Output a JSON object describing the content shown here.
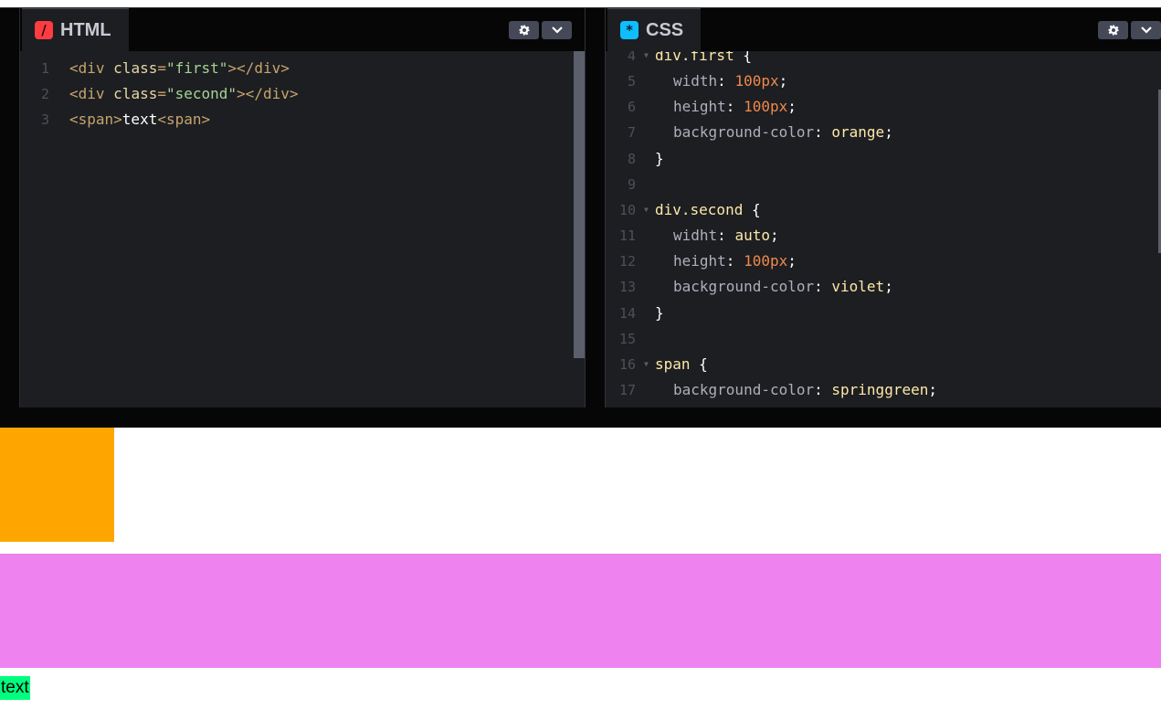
{
  "html_panel": {
    "tab_label": "HTML",
    "tab_icon": "html-slash-icon",
    "lines": [
      {
        "num": "1",
        "tokens": [
          [
            "t-tag",
            "<div "
          ],
          [
            "t-attr",
            "class"
          ],
          [
            "t-tag",
            "="
          ],
          [
            "t-str",
            "\"first\""
          ],
          [
            "t-tag",
            "></div>"
          ]
        ]
      },
      {
        "num": "2",
        "tokens": [
          [
            "t-tag",
            "<div "
          ],
          [
            "t-attr",
            "class"
          ],
          [
            "t-tag",
            "="
          ],
          [
            "t-str",
            "\"second\""
          ],
          [
            "t-tag",
            "></div>"
          ]
        ]
      },
      {
        "num": "3",
        "tokens": [
          [
            "t-tag",
            "<span>"
          ],
          [
            "t-text",
            "text"
          ],
          [
            "t-tag",
            "<span>"
          ]
        ]
      }
    ]
  },
  "css_panel": {
    "tab_label": "CSS",
    "tab_icon": "css-asterisk-icon",
    "lines": [
      {
        "num": "4",
        "fold": true,
        "indent": 0,
        "tokens": [
          [
            "t-sel",
            "div.first "
          ],
          [
            "t-pun",
            "{"
          ]
        ]
      },
      {
        "num": "5",
        "indent": 1,
        "tokens": [
          [
            "t-prop",
            "width"
          ],
          [
            "t-pun",
            ": "
          ],
          [
            "t-num",
            "100px"
          ],
          [
            "t-pun",
            ";"
          ]
        ]
      },
      {
        "num": "6",
        "indent": 1,
        "tokens": [
          [
            "t-prop",
            "height"
          ],
          [
            "t-pun",
            ": "
          ],
          [
            "t-num",
            "100px"
          ],
          [
            "t-pun",
            ";"
          ]
        ]
      },
      {
        "num": "7",
        "indent": 1,
        "tokens": [
          [
            "t-prop",
            "background-color"
          ],
          [
            "t-pun",
            ": "
          ],
          [
            "t-val",
            "orange"
          ],
          [
            "t-pun",
            ";"
          ]
        ]
      },
      {
        "num": "8",
        "indent": 0,
        "tokens": [
          [
            "t-pun",
            "}"
          ]
        ]
      },
      {
        "num": "9",
        "indent": 0,
        "tokens": []
      },
      {
        "num": "10",
        "fold": true,
        "indent": 0,
        "tokens": [
          [
            "t-sel",
            "div.second "
          ],
          [
            "t-pun",
            "{"
          ]
        ]
      },
      {
        "num": "11",
        "indent": 1,
        "tokens": [
          [
            "t-prop",
            "widht"
          ],
          [
            "t-pun",
            ": "
          ],
          [
            "t-val",
            "auto"
          ],
          [
            "t-pun",
            ";"
          ]
        ]
      },
      {
        "num": "12",
        "indent": 1,
        "tokens": [
          [
            "t-prop",
            "height"
          ],
          [
            "t-pun",
            ": "
          ],
          [
            "t-num",
            "100px"
          ],
          [
            "t-pun",
            ";"
          ]
        ]
      },
      {
        "num": "13",
        "indent": 1,
        "tokens": [
          [
            "t-prop",
            "background-color"
          ],
          [
            "t-pun",
            ": "
          ],
          [
            "t-val",
            "violet"
          ],
          [
            "t-pun",
            ";"
          ]
        ]
      },
      {
        "num": "14",
        "indent": 0,
        "tokens": [
          [
            "t-pun",
            "}"
          ]
        ]
      },
      {
        "num": "15",
        "indent": 0,
        "tokens": []
      },
      {
        "num": "16",
        "fold": true,
        "indent": 0,
        "tokens": [
          [
            "t-sel",
            "span "
          ],
          [
            "t-pun",
            "{"
          ]
        ]
      },
      {
        "num": "17",
        "indent": 1,
        "tokens": [
          [
            "t-prop",
            "background-color"
          ],
          [
            "t-pun",
            ": "
          ],
          [
            "t-val",
            "springgreen"
          ],
          [
            "t-pun",
            ";"
          ]
        ]
      }
    ]
  },
  "toolbar_icons": [
    "gear-icon",
    "chevron-down-icon"
  ],
  "preview": {
    "first_color": "#ffa500",
    "second_color": "#ee82ee",
    "span_color": "#00ff7f",
    "span_text": "text"
  }
}
